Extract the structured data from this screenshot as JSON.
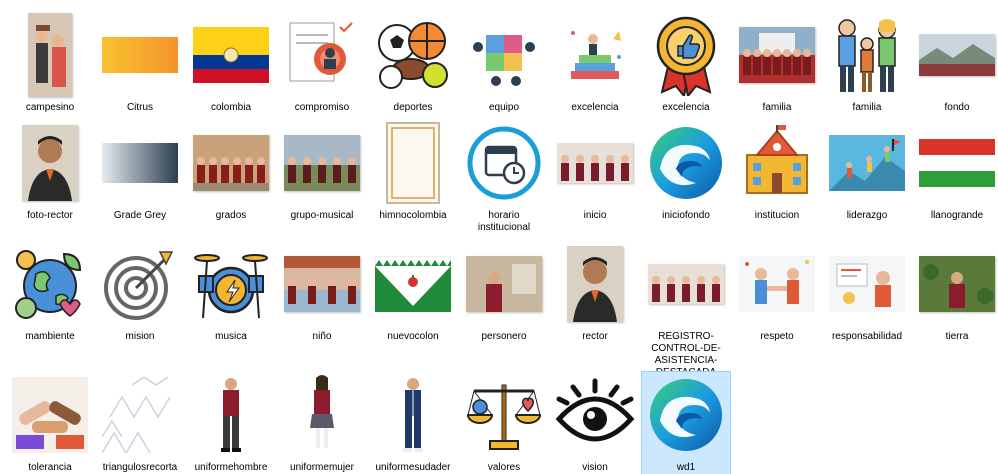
{
  "files": [
    {
      "name": "campesino",
      "icon": "photo-couple-icon"
    },
    {
      "name": "Citrus",
      "icon": "gradient-orange-icon"
    },
    {
      "name": "colombia",
      "icon": "flag-colombia-icon"
    },
    {
      "name": "compromiso",
      "icon": "commitment-badge-icon"
    },
    {
      "name": "deportes",
      "icon": "sports-balls-icon"
    },
    {
      "name": "equipo",
      "icon": "team-puzzle-icon"
    },
    {
      "name": "excelencia",
      "icon": "trophy-books-icon"
    },
    {
      "name": "excelencia",
      "icon": "award-medal-icon"
    },
    {
      "name": "familia",
      "icon": "photo-crowd-icon"
    },
    {
      "name": "familia",
      "icon": "family-illustration-icon"
    },
    {
      "name": "fondo",
      "icon": "photo-landscape-icon"
    },
    {
      "name": "foto-rector",
      "icon": "photo-portrait-icon"
    },
    {
      "name": "Grade Grey",
      "icon": "gradient-grey-icon"
    },
    {
      "name": "grados",
      "icon": "photo-graduates-icon"
    },
    {
      "name": "grupo-musical",
      "icon": "photo-band-icon"
    },
    {
      "name": "himnocolombia",
      "icon": "document-frame-icon"
    },
    {
      "name": "horario institucional",
      "icon": "calendar-clock-icon"
    },
    {
      "name": "inicio",
      "icon": "photo-students-icon"
    },
    {
      "name": "iniciofondo",
      "icon": "edge-browser-icon"
    },
    {
      "name": "institucion",
      "icon": "school-building-icon"
    },
    {
      "name": "liderazgo",
      "icon": "leadership-illustration-icon"
    },
    {
      "name": "llanogrande",
      "icon": "flag-llanogrande-icon"
    },
    {
      "name": "mambiente",
      "icon": "earth-ecology-icon"
    },
    {
      "name": "mision",
      "icon": "target-arrow-icon"
    },
    {
      "name": "musica",
      "icon": "drum-kit-icon"
    },
    {
      "name": "niño",
      "icon": "photo-courtyard-icon"
    },
    {
      "name": "nuevocolon",
      "icon": "flag-nuevocolon-icon"
    },
    {
      "name": "personero",
      "icon": "photo-student-icon"
    },
    {
      "name": "rector",
      "icon": "photo-portrait-icon"
    },
    {
      "name": "REGISTRO-CONTROL-DE-ASISTENCIA-DESTACADA",
      "icon": "photo-students-icon"
    },
    {
      "name": "respeto",
      "icon": "respect-illustration-icon"
    },
    {
      "name": "responsabilidad",
      "icon": "responsibility-illustration-icon"
    },
    {
      "name": "tierra",
      "icon": "photo-garden-icon"
    },
    {
      "name": "tolerancia",
      "icon": "hands-together-icon"
    },
    {
      "name": "triangulosrecorta",
      "icon": "triangle-pattern-icon"
    },
    {
      "name": "uniformehombre",
      "icon": "uniform-boy-icon"
    },
    {
      "name": "uniformemujer",
      "icon": "uniform-girl-icon"
    },
    {
      "name": "uniformesudader",
      "icon": "uniform-tracksuit-icon"
    },
    {
      "name": "valores",
      "icon": "balance-scale-icon"
    },
    {
      "name": "vision",
      "icon": "eye-icon"
    },
    {
      "name": "wd1",
      "icon": "edge-browser-icon",
      "selected": true
    }
  ]
}
